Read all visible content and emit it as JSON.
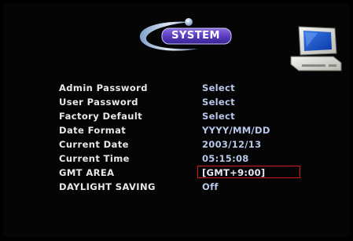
{
  "logo": {
    "title": "SYSTEM"
  },
  "icons": {
    "computer": "computer-monitor-icon"
  },
  "settings": [
    {
      "label": "Admin Password",
      "value": "Select"
    },
    {
      "label": "User Password",
      "value": "Select"
    },
    {
      "label": "Factory Default",
      "value": "Select"
    },
    {
      "label": "Date Format",
      "value": "YYYY/MM/DD"
    },
    {
      "label": "Current Date",
      "value": "2003/12/13"
    },
    {
      "label": "Current Time",
      "value": "05:15:08"
    },
    {
      "label": "GMT AREA",
      "value": "[GMT+9:00]"
    },
    {
      "label": "DAYLIGHT SAVING",
      "value": "Off"
    }
  ],
  "selected_index": 6,
  "colors": {
    "background": "#000000",
    "label": "#e8e8e8",
    "value": "#b8c8ea",
    "selection_border": "#d81818"
  }
}
